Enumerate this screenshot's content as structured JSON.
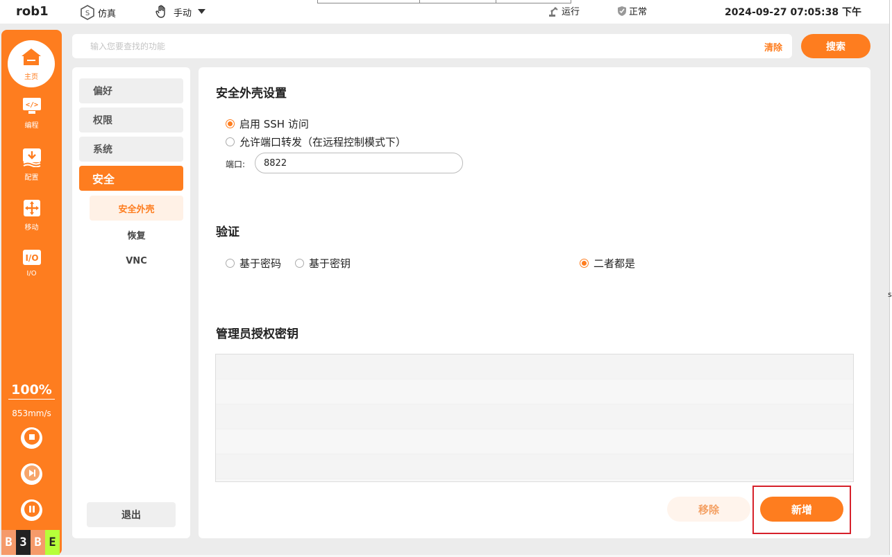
{
  "header": {
    "robot_name": "rob1",
    "mode_sim": "仿真",
    "mode_manual": "手动",
    "run_state": "运行",
    "safety_state": "正常",
    "datetime": "2024-09-27 07:05:38 下午"
  },
  "sidebar": {
    "home_label": "主页",
    "items": [
      {
        "label": "编程",
        "icon": "code-icon"
      },
      {
        "label": "配置",
        "icon": "download-icon"
      },
      {
        "label": "移动",
        "icon": "move-icon"
      },
      {
        "label": "I/O",
        "icon": "io-icon"
      }
    ],
    "speed_percent": "100%",
    "speed_value": "853mm/s",
    "badges": [
      "B",
      "3",
      "B",
      "E"
    ]
  },
  "search": {
    "placeholder": "输入您要查找的功能",
    "clear_label": "清除",
    "search_label": "搜索"
  },
  "menu": {
    "items": [
      "偏好",
      "权限",
      "系统",
      "安全"
    ],
    "sub_items": [
      "安全外壳",
      "恢复",
      "VNC"
    ],
    "exit_label": "退出"
  },
  "content": {
    "ssh_title": "安全外壳设置",
    "enable_ssh": "启用 SSH 访问",
    "allow_port_forward": "允许端口转发（在远程控制模式下）",
    "port_label": "端口:",
    "port_value": "8822",
    "auth_title": "验证",
    "auth_password": "基于密码",
    "auth_key": "基于密钥",
    "auth_both": "二者都是",
    "admin_keys_title": "管理员授权密钥",
    "remove_label": "移除",
    "add_label": "新增"
  },
  "colors": {
    "accent": "#fe7d1f",
    "highlight": "#d6202a"
  },
  "right_fragment": "s"
}
